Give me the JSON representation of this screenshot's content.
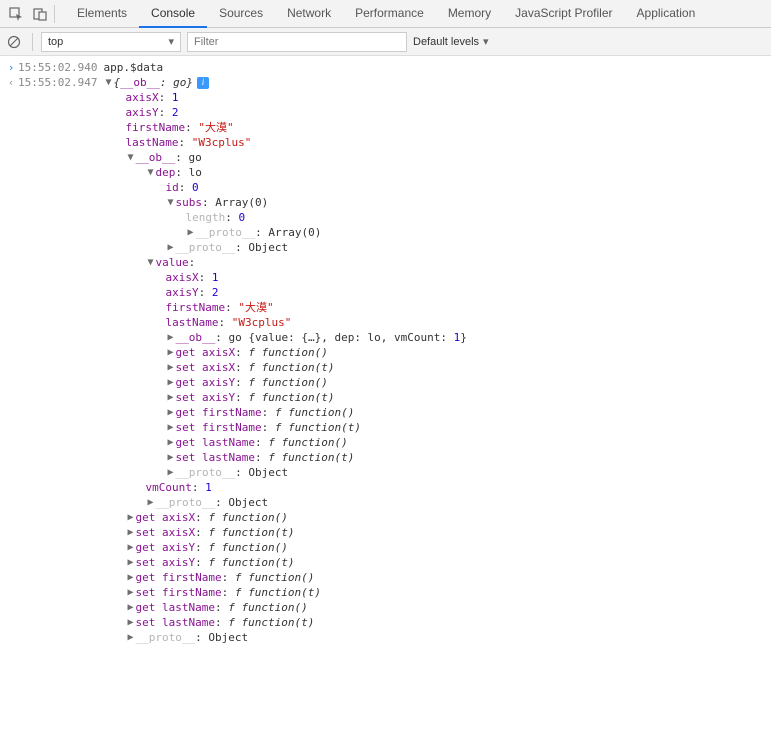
{
  "tabs": {
    "elements": "Elements",
    "console": "Console",
    "sources": "Sources",
    "network": "Network",
    "performance": "Performance",
    "memory": "Memory",
    "jsprofiler": "JavaScript Profiler",
    "application": "Application"
  },
  "filter": {
    "context": "top",
    "placeholder": "Filter",
    "levels": "Default levels"
  },
  "log": {
    "ts1": "15:55:02.940",
    "cmd": "app.$data",
    "ts2": "15:55:02.947",
    "root": "{__ob__: go}",
    "axisX": "axisX",
    "axisY": "axisY",
    "firstName": "firstName",
    "lastName": "lastName",
    "ob": "__ob__",
    "go": "go",
    "dep": "dep",
    "lo": "lo",
    "id": "id",
    "subs": "subs",
    "arr0": "Array(0)",
    "length": "length",
    "proto": "__proto__",
    "object": "Object",
    "value": "value",
    "goSummary": "go {value: {…}, dep: lo, vmCount: ",
    "goSummaryEnd": "}",
    "get": "get ",
    "set": "set ",
    "fkw": "f ",
    "fn0": "function()",
    "fnt": "function(t)",
    "vmCount": "vmCount",
    "n0": "0",
    "n1": "1",
    "n2": "2",
    "s1": "\"大漠\"",
    "s2": "\"W3cplus\""
  }
}
